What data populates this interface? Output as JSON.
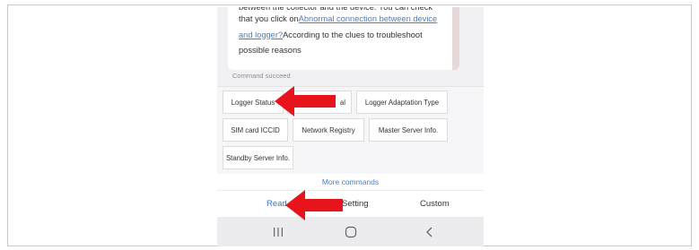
{
  "message": {
    "cut_line": "between the collector and the device. You can check",
    "line_prefix": "that you click on",
    "link_text_1": "Abnormal connection between device",
    "link_text_2": "and logger?",
    "line_suffix": "According to the clues to troubleshoot",
    "line_last": "possible reasons"
  },
  "status_text": "Command succeed",
  "commands": {
    "logger_status": "Logger Status",
    "hidden_signal": "al",
    "logger_adaptation_type": "Logger Adaptation Type",
    "sim_card_iccid": "SIM card ICCID",
    "network_registry": "Network Registry",
    "master_server_info": "Master Server Info.",
    "standby_server_info": "Standby Server Info."
  },
  "more_commands": "More commands",
  "tabs": {
    "read": "Read",
    "setting": "Setting",
    "custom": "Custom"
  },
  "nav": {
    "recents_icon": "recents-icon",
    "home_icon": "home-icon",
    "back_icon": "back-icon"
  },
  "colors": {
    "accent": "#3b74c0",
    "arrow": "#e8141c"
  }
}
